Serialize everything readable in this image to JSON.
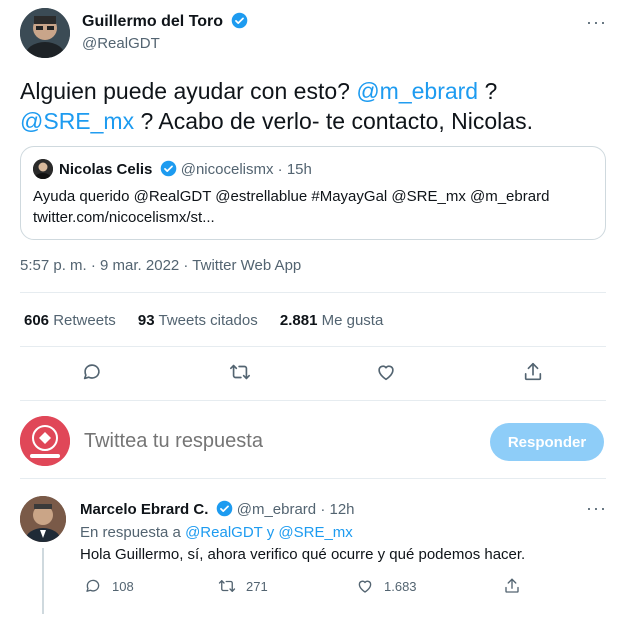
{
  "main_tweet": {
    "author_name": "Guillermo del Toro",
    "author_handle": "@RealGDT",
    "text_before": "Alguien puede ayudar con esto? ",
    "mention_1": "@m_ebrard",
    "text_middle": " ? ",
    "mention_2": "@SRE_mx",
    "text_after": " ? Acabo de verlo- te contacto, Nicolas.",
    "more_label": "···",
    "timestamp": "5:57 p. m. · 9 mar. 2022 · Twitter Web App"
  },
  "quote": {
    "name": "Nicolas Celis",
    "handle": "@nicocelismx",
    "time": "· 15h",
    "text_line1": "Ayuda querido @RealGDT @estrellablue #MayayGal @SRE_mx @m_ebrard",
    "text_line2": "twitter.com/nicocelismx/st..."
  },
  "stats": {
    "retweets": "606",
    "retweets_label": "Retweets",
    "quotes": "93",
    "quotes_label": "Tweets citados",
    "likes": "2.881",
    "likes_label": "Me gusta"
  },
  "actions": [
    "reply-icon",
    "retweet-icon",
    "like-icon",
    "share-icon"
  ],
  "composer": {
    "placeholder": "Twittea tu respuesta",
    "button_label": "Responder"
  },
  "reply": {
    "name": "Marcelo Ebrard C.",
    "handle": "@m_ebrard",
    "time": "· 12h",
    "replying_prefix": "En respuesta a ",
    "replying_users": "@RealGDT y @SRE_mx",
    "text": "Hola Guillermo, sí, ahora verifico qué ocurre y qué podemos hacer.",
    "reply_count": "108",
    "retweet_count": "271",
    "like_count": "1.683",
    "more_label": "···"
  },
  "colors": {
    "accent": "#1d9bf0",
    "muted": "#536471",
    "button_disabled": "#8ecdf8"
  }
}
